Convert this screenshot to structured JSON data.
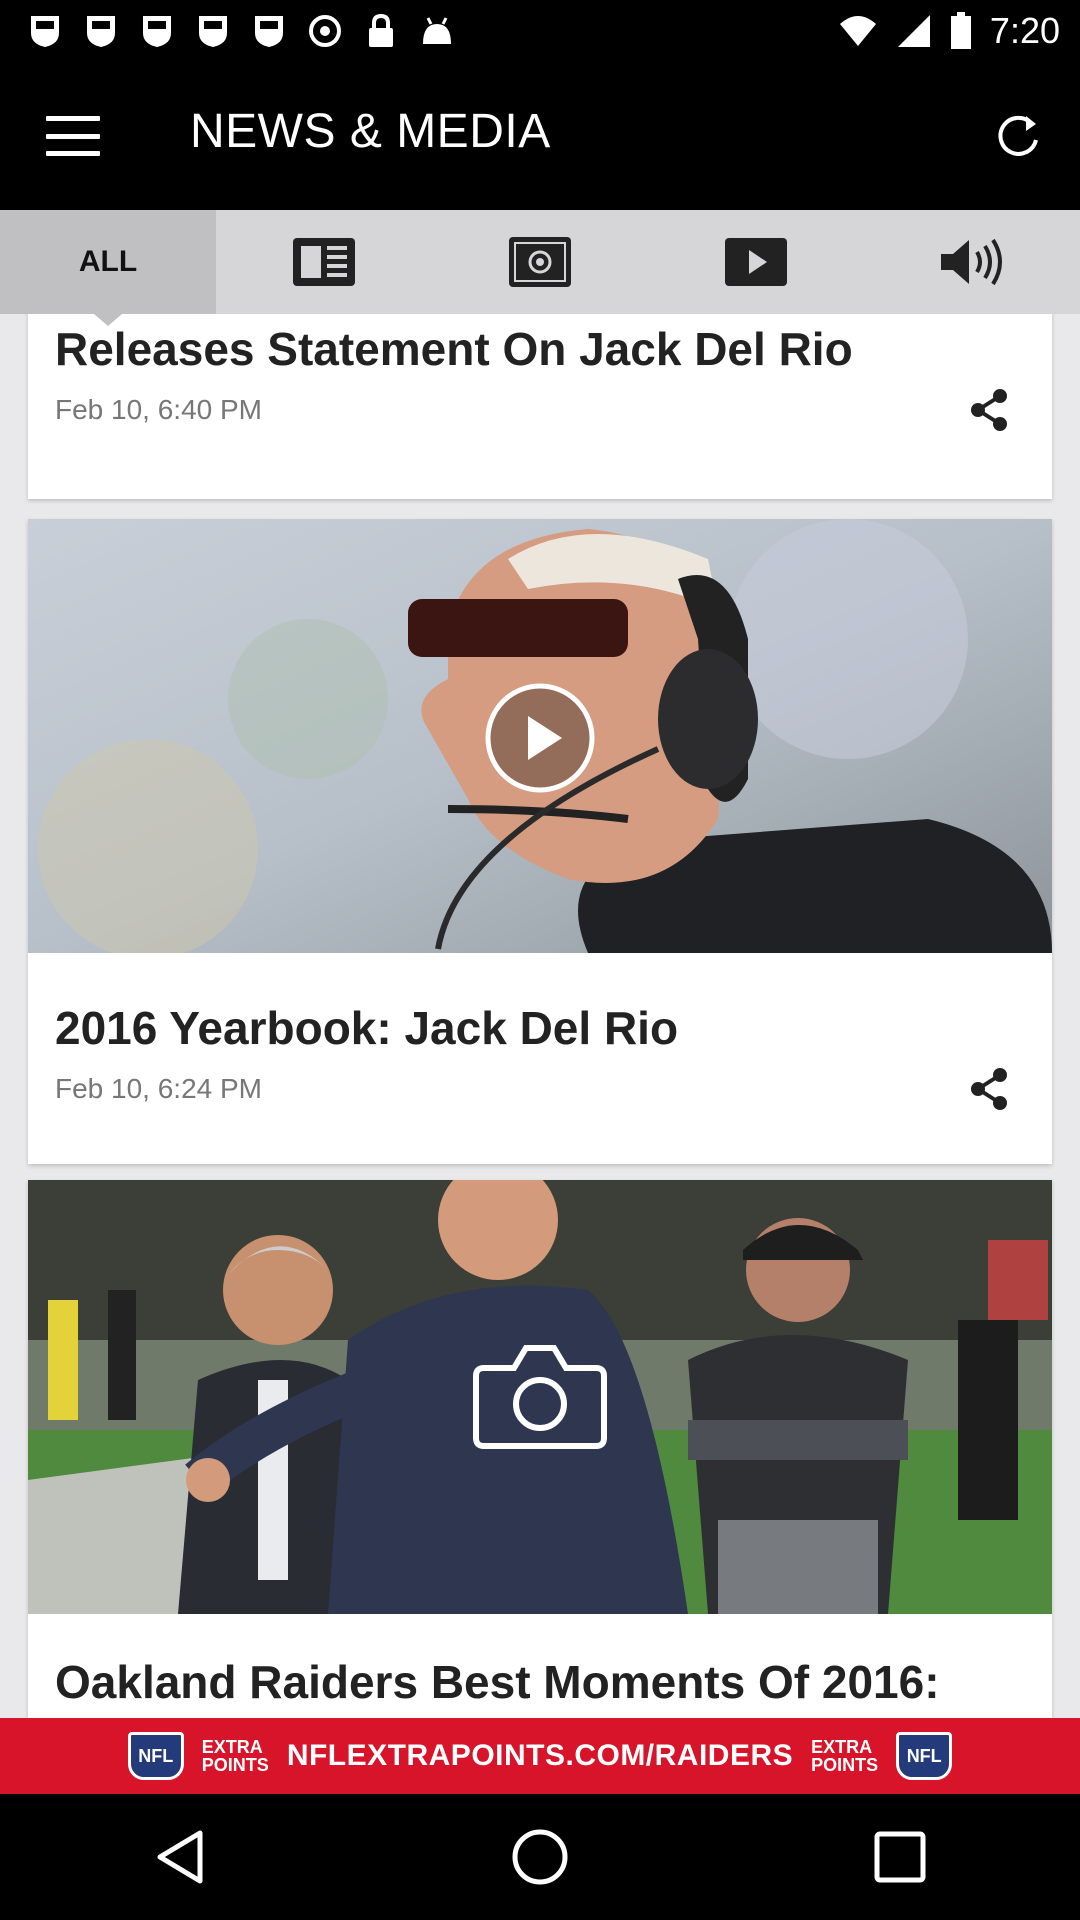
{
  "status_bar": {
    "time": "7:20",
    "icons": [
      "nfl-shield-icon",
      "nfl-shield-icon",
      "nfl-shield-icon",
      "nfl-shield-icon",
      "nfl-shield-icon",
      "sync-icon",
      "lock-icon",
      "android-icon"
    ]
  },
  "app_bar": {
    "title": "NEWS & MEDIA",
    "menu_icon": "menu-icon",
    "refresh_icon": "refresh-icon"
  },
  "tabs": [
    {
      "label": "ALL",
      "active": true
    },
    {
      "icon": "articles-icon",
      "active": false
    },
    {
      "icon": "photos-icon",
      "active": false
    },
    {
      "icon": "video-icon",
      "active": false
    },
    {
      "icon": "audio-icon",
      "active": false
    }
  ],
  "cards": [
    {
      "title": "Releases Statement On Jack Del Rio",
      "date": "Feb 10, 6:40 PM",
      "media": "none"
    },
    {
      "title": "2016 Yearbook: Jack Del Rio",
      "date": "Feb 10, 6:24 PM",
      "media": "video"
    },
    {
      "title": "Oakland Raiders Best Moments Of 2016:",
      "media": "photo"
    }
  ],
  "ad": {
    "text": "NFLEXTRAPOINTS.COM/RAIDERS",
    "badge_line1": "EXTRA",
    "badge_line2": "POINTS",
    "shield_label": "NFL"
  },
  "colors": {
    "ad_red": "#d8142a",
    "tab_bar": "#d6d6d8",
    "active_tab": "#c0c0c3"
  }
}
